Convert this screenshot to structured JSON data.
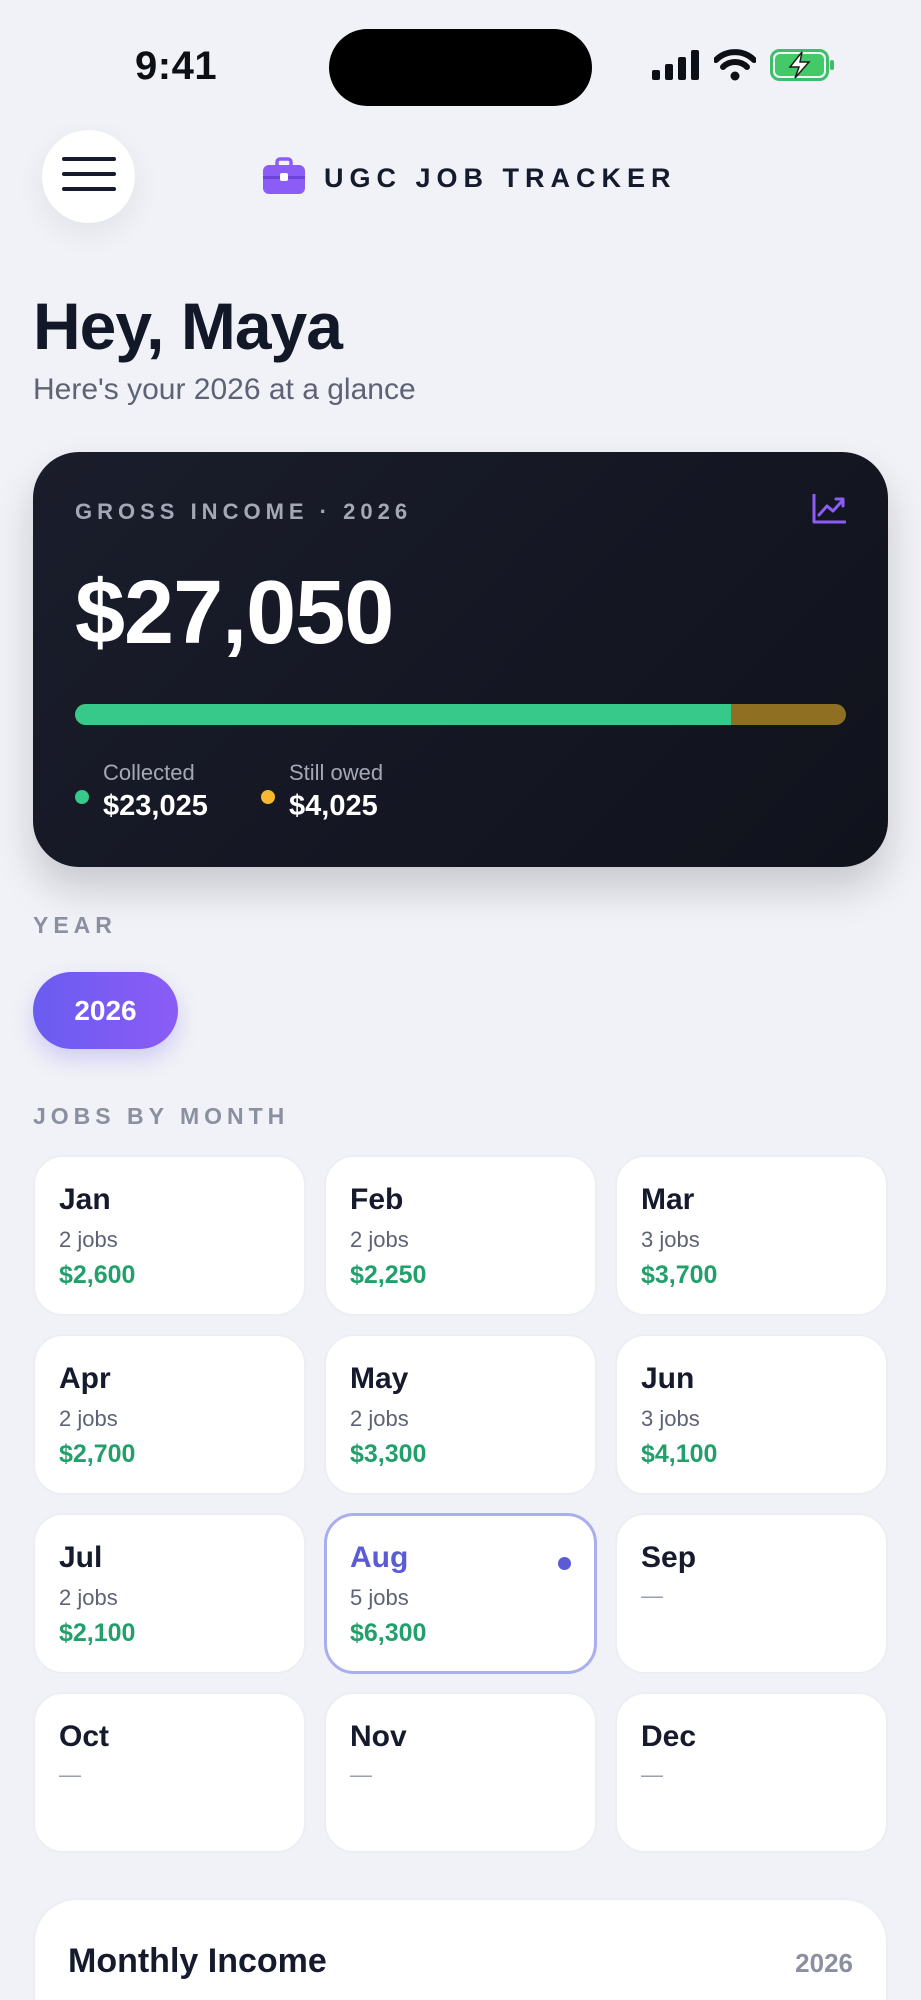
{
  "status_bar": {
    "time": "9:41"
  },
  "header": {
    "app_title": "UGC JOB TRACKER"
  },
  "greeting": {
    "title": "Hey, Maya",
    "subtitle": "Here's your 2026 at a glance"
  },
  "income": {
    "label": "GROSS INCOME · 2026",
    "total": "$27,050",
    "collected_fraction": 0.851,
    "collected_label": "Collected",
    "collected_value": "$23,025",
    "owed_label": "Still owed",
    "owed_value": "$4,025",
    "colors": {
      "collected": "#37c989",
      "owed": "#f5b82e"
    }
  },
  "year_section": {
    "label": "YEAR",
    "selected_year": "2026"
  },
  "months_section": {
    "label": "JOBS BY MONTH",
    "months": [
      {
        "name": "Jan",
        "jobs": "2 jobs",
        "amount": "$2,600",
        "selected": false
      },
      {
        "name": "Feb",
        "jobs": "2 jobs",
        "amount": "$2,250",
        "selected": false
      },
      {
        "name": "Mar",
        "jobs": "3 jobs",
        "amount": "$3,700",
        "selected": false
      },
      {
        "name": "Apr",
        "jobs": "2 jobs",
        "amount": "$2,700",
        "selected": false
      },
      {
        "name": "May",
        "jobs": "2 jobs",
        "amount": "$3,300",
        "selected": false
      },
      {
        "name": "Jun",
        "jobs": "3 jobs",
        "amount": "$4,100",
        "selected": false
      },
      {
        "name": "Jul",
        "jobs": "2 jobs",
        "amount": "$2,100",
        "selected": false
      },
      {
        "name": "Aug",
        "jobs": "5 jobs",
        "amount": "$6,300",
        "selected": true
      },
      {
        "name": "Sep",
        "jobs": "",
        "amount": "—",
        "selected": false
      },
      {
        "name": "Oct",
        "jobs": "",
        "amount": "—",
        "selected": false
      },
      {
        "name": "Nov",
        "jobs": "",
        "amount": "—",
        "selected": false
      },
      {
        "name": "Dec",
        "jobs": "",
        "amount": "—",
        "selected": false
      }
    ]
  },
  "monthly_income": {
    "title": "Monthly Income",
    "year": "2026"
  }
}
